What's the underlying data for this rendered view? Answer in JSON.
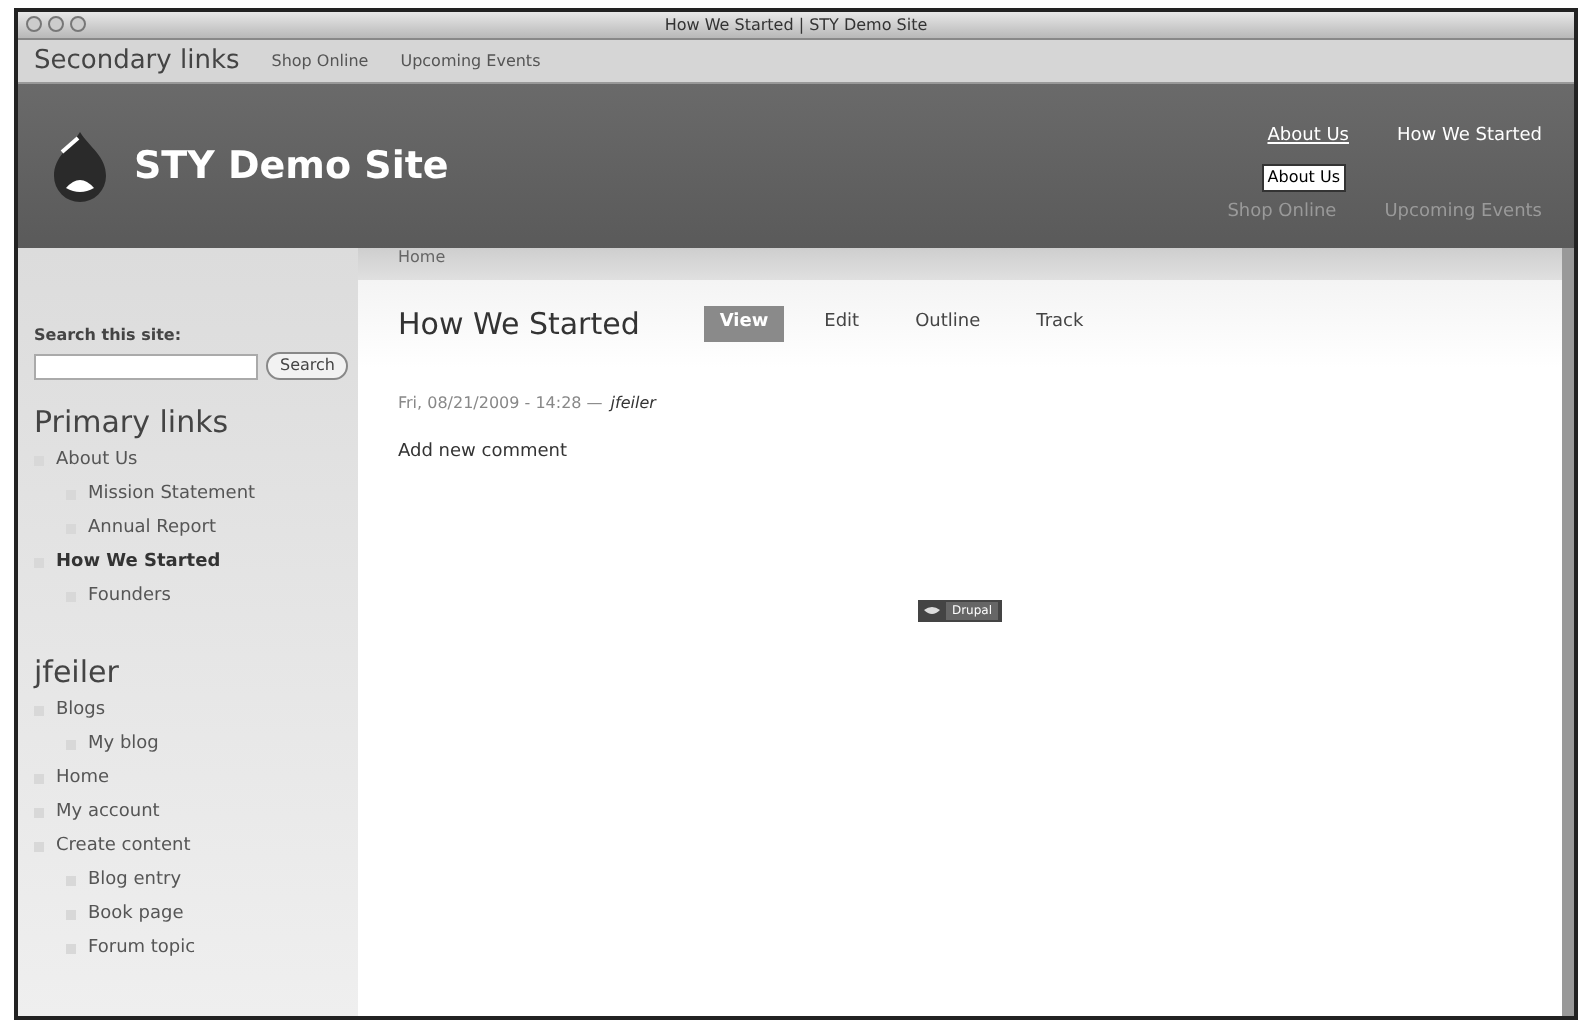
{
  "window": {
    "title": "How We Started | STY Demo Site"
  },
  "secondary_bar": {
    "title": "Secondary links",
    "links": [
      "Shop Online",
      "Upcoming Events"
    ]
  },
  "header": {
    "site_name": "STY Demo Site",
    "primary_links": [
      {
        "label": "About Us",
        "hovered": true
      },
      {
        "label": "How We Started",
        "hovered": false
      }
    ],
    "secondary_links": [
      "Shop Online",
      "Upcoming Events"
    ],
    "tooltip": "About Us"
  },
  "search": {
    "label": "Search this site:",
    "button": "Search"
  },
  "primary_menu": {
    "title": "Primary links",
    "items": [
      {
        "label": "About Us",
        "selected": false,
        "children": [
          {
            "label": "Mission Statement",
            "selected": false
          },
          {
            "label": "Annual Report",
            "selected": false
          }
        ]
      },
      {
        "label": "How We Started",
        "selected": true,
        "children": [
          {
            "label": "Founders",
            "selected": false
          }
        ]
      }
    ]
  },
  "user_menu": {
    "title": "jfeiler",
    "items": [
      {
        "label": "Blogs",
        "children": [
          {
            "label": "My blog"
          }
        ]
      },
      {
        "label": "Home"
      },
      {
        "label": "My account"
      },
      {
        "label": "Create content",
        "children": [
          {
            "label": "Blog entry"
          },
          {
            "label": "Book page"
          },
          {
            "label": "Forum topic"
          }
        ]
      }
    ]
  },
  "breadcrumb": "Home",
  "page": {
    "title": "How We Started",
    "tabs": [
      {
        "label": "View",
        "selected": true
      },
      {
        "label": "Edit",
        "selected": false
      },
      {
        "label": "Outline",
        "selected": false
      },
      {
        "label": "Track",
        "selected": false
      }
    ],
    "submitted": "Fri, 08/21/2009 - 14:28 —",
    "author": "jfeiler",
    "links": [
      "Add new comment"
    ],
    "badge": "Drupal"
  }
}
